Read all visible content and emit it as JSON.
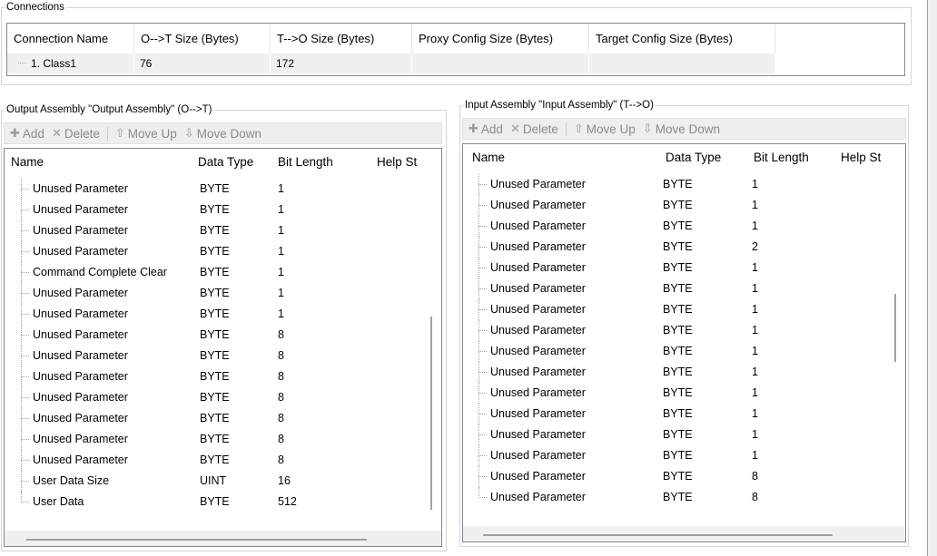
{
  "connections": {
    "title": "Connections",
    "columns": [
      "Connection Name",
      "O-->T Size (Bytes)",
      "T-->O Size (Bytes)",
      "Proxy Config Size (Bytes)",
      "Target Config Size (Bytes)"
    ],
    "rows": [
      [
        "1. Class1",
        "76",
        "172",
        "",
        ""
      ]
    ]
  },
  "toolbar": {
    "add": "Add",
    "delete": "Delete",
    "move_up": "Move Up",
    "move_down": "Move Down"
  },
  "output_assembly": {
    "title": "Output Assembly \"Output Assembly\" (O-->T)",
    "columns": [
      "Name",
      "Data Type",
      "Bit Length",
      "Help St"
    ],
    "rows": [
      [
        "Unused Parameter",
        "BYTE",
        "1"
      ],
      [
        "Unused Parameter",
        "BYTE",
        "1"
      ],
      [
        "Unused Parameter",
        "BYTE",
        "1"
      ],
      [
        "Unused Parameter",
        "BYTE",
        "1"
      ],
      [
        "Command Complete Clear",
        "BYTE",
        "1"
      ],
      [
        "Unused Parameter",
        "BYTE",
        "1"
      ],
      [
        "Unused Parameter",
        "BYTE",
        "1"
      ],
      [
        "Unused Parameter",
        "BYTE",
        "8"
      ],
      [
        "Unused Parameter",
        "BYTE",
        "8"
      ],
      [
        "Unused Parameter",
        "BYTE",
        "8"
      ],
      [
        "Unused Parameter",
        "BYTE",
        "8"
      ],
      [
        "Unused Parameter",
        "BYTE",
        "8"
      ],
      [
        "Unused Parameter",
        "BYTE",
        "8"
      ],
      [
        "Unused Parameter",
        "BYTE",
        "8"
      ],
      [
        "User Data Size",
        "UINT",
        "16"
      ],
      [
        "User Data",
        "BYTE",
        "512"
      ]
    ]
  },
  "input_assembly": {
    "title": "Input Assembly \"Input Assembly\" (T-->O)",
    "columns": [
      "Name",
      "Data Type",
      "Bit Length",
      "Help St"
    ],
    "rows": [
      [
        "Unused Parameter",
        "BYTE",
        "1"
      ],
      [
        "Unused Parameter",
        "BYTE",
        "1"
      ],
      [
        "Unused Parameter",
        "BYTE",
        "1"
      ],
      [
        "Unused Parameter",
        "BYTE",
        "2"
      ],
      [
        "Unused Parameter",
        "BYTE",
        "1"
      ],
      [
        "Unused Parameter",
        "BYTE",
        "1"
      ],
      [
        "Unused Parameter",
        "BYTE",
        "1"
      ],
      [
        "Unused Parameter",
        "BYTE",
        "1"
      ],
      [
        "Unused Parameter",
        "BYTE",
        "1"
      ],
      [
        "Unused Parameter",
        "BYTE",
        "1"
      ],
      [
        "Unused Parameter",
        "BYTE",
        "1"
      ],
      [
        "Unused Parameter",
        "BYTE",
        "1"
      ],
      [
        "Unused Parameter",
        "BYTE",
        "1"
      ],
      [
        "Unused Parameter",
        "BYTE",
        "1"
      ],
      [
        "Unused Parameter",
        "BYTE",
        "8"
      ],
      [
        "Unused Parameter",
        "BYTE",
        "8"
      ]
    ]
  },
  "icons": {
    "add": "plus-icon",
    "delete": "x-icon",
    "move_up": "arrow-up-icon",
    "move_down": "arrow-down-icon"
  }
}
